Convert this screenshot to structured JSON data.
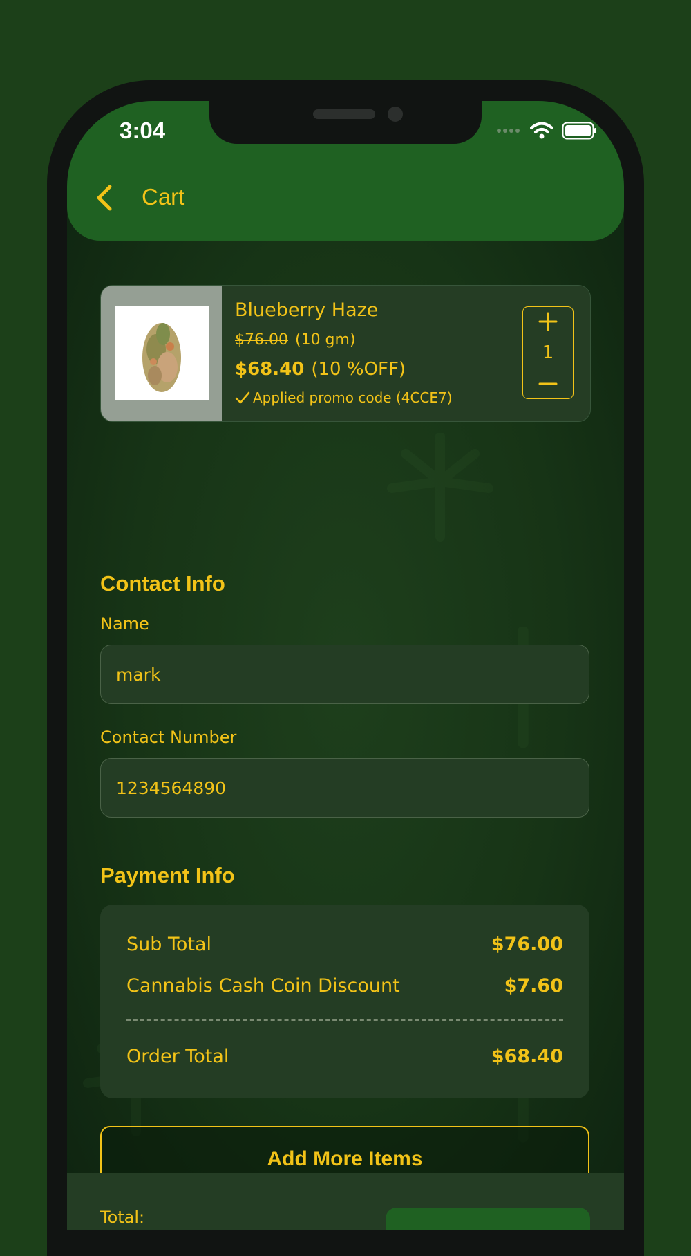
{
  "status_bar": {
    "time": "3:04"
  },
  "header": {
    "title": "Cart"
  },
  "cart_item": {
    "name": "Blueberry  Haze",
    "original_price": "$76.00",
    "weight": "(10 gm)",
    "price": "$68.40",
    "discount": "(10 %OFF)",
    "promo": "Applied promo code (4CCE7)",
    "quantity": "1"
  },
  "contact": {
    "section_title": "Contact Info",
    "name_label": "Name",
    "name_value": "mark",
    "number_label": "Contact Number",
    "number_value": "1234564890"
  },
  "payment": {
    "section_title": "Payment Info",
    "rows": [
      {
        "label": "Sub Total",
        "value": "$76.00"
      },
      {
        "label": "Cannabis Cash Coin Discount",
        "value": "$7.60"
      },
      {
        "label": "Order Total",
        "value": "$68.40"
      }
    ]
  },
  "actions": {
    "add_more": "Add More Items"
  },
  "footer": {
    "total_label": "Total:"
  },
  "colors": {
    "accent": "#f2c318",
    "header_green": "#1f6122",
    "card": "#243d24"
  }
}
